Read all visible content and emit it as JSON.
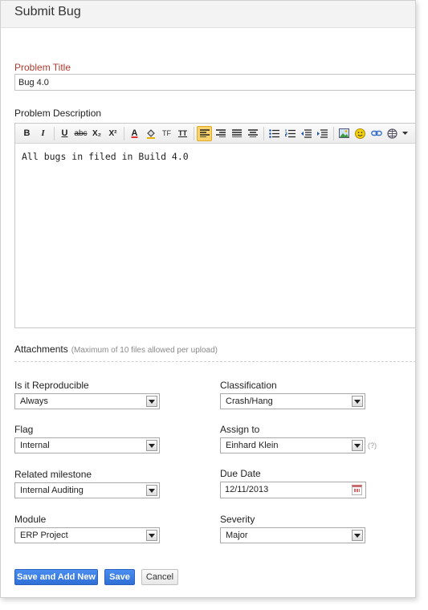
{
  "header": {
    "title": "Submit Bug"
  },
  "problem_title": {
    "label": "Problem Title",
    "value": "Bug 4.0"
  },
  "problem_description": {
    "label": "Problem Description",
    "body": "All bugs in filed in Build 4.0",
    "toolbar": {
      "bold": "B",
      "italic": "I",
      "underline": "U",
      "strike": "abc",
      "subscript": "X₂",
      "superscript": "X²",
      "font_color": "A",
      "line_height": "TF",
      "text_size": "TT"
    }
  },
  "attachments": {
    "label": "Attachments",
    "hint": "(Maximum of 10 files allowed per upload)"
  },
  "fields": {
    "reproducible": {
      "label": "Is it Reproducible",
      "value": "Always"
    },
    "classification": {
      "label": "Classification",
      "value": "Crash/Hang"
    },
    "flag": {
      "label": "Flag",
      "value": "Internal"
    },
    "assign_to": {
      "label": "Assign to",
      "value": "Einhard Klein",
      "help": "(?)"
    },
    "milestone": {
      "label": "Related milestone",
      "value": "Internal Auditing"
    },
    "due_date": {
      "label": "Due Date",
      "value": "12/11/2013"
    },
    "module": {
      "label": "Module",
      "value": "ERP Project"
    },
    "severity": {
      "label": "Severity",
      "value": "Major"
    }
  },
  "buttons": {
    "save_add_new": "Save and Add New",
    "save": "Save",
    "cancel": "Cancel"
  },
  "colors": {
    "primary_button": "#2f6fd6",
    "required_label": "#b03a2e",
    "align_active": "#fbd36c"
  }
}
